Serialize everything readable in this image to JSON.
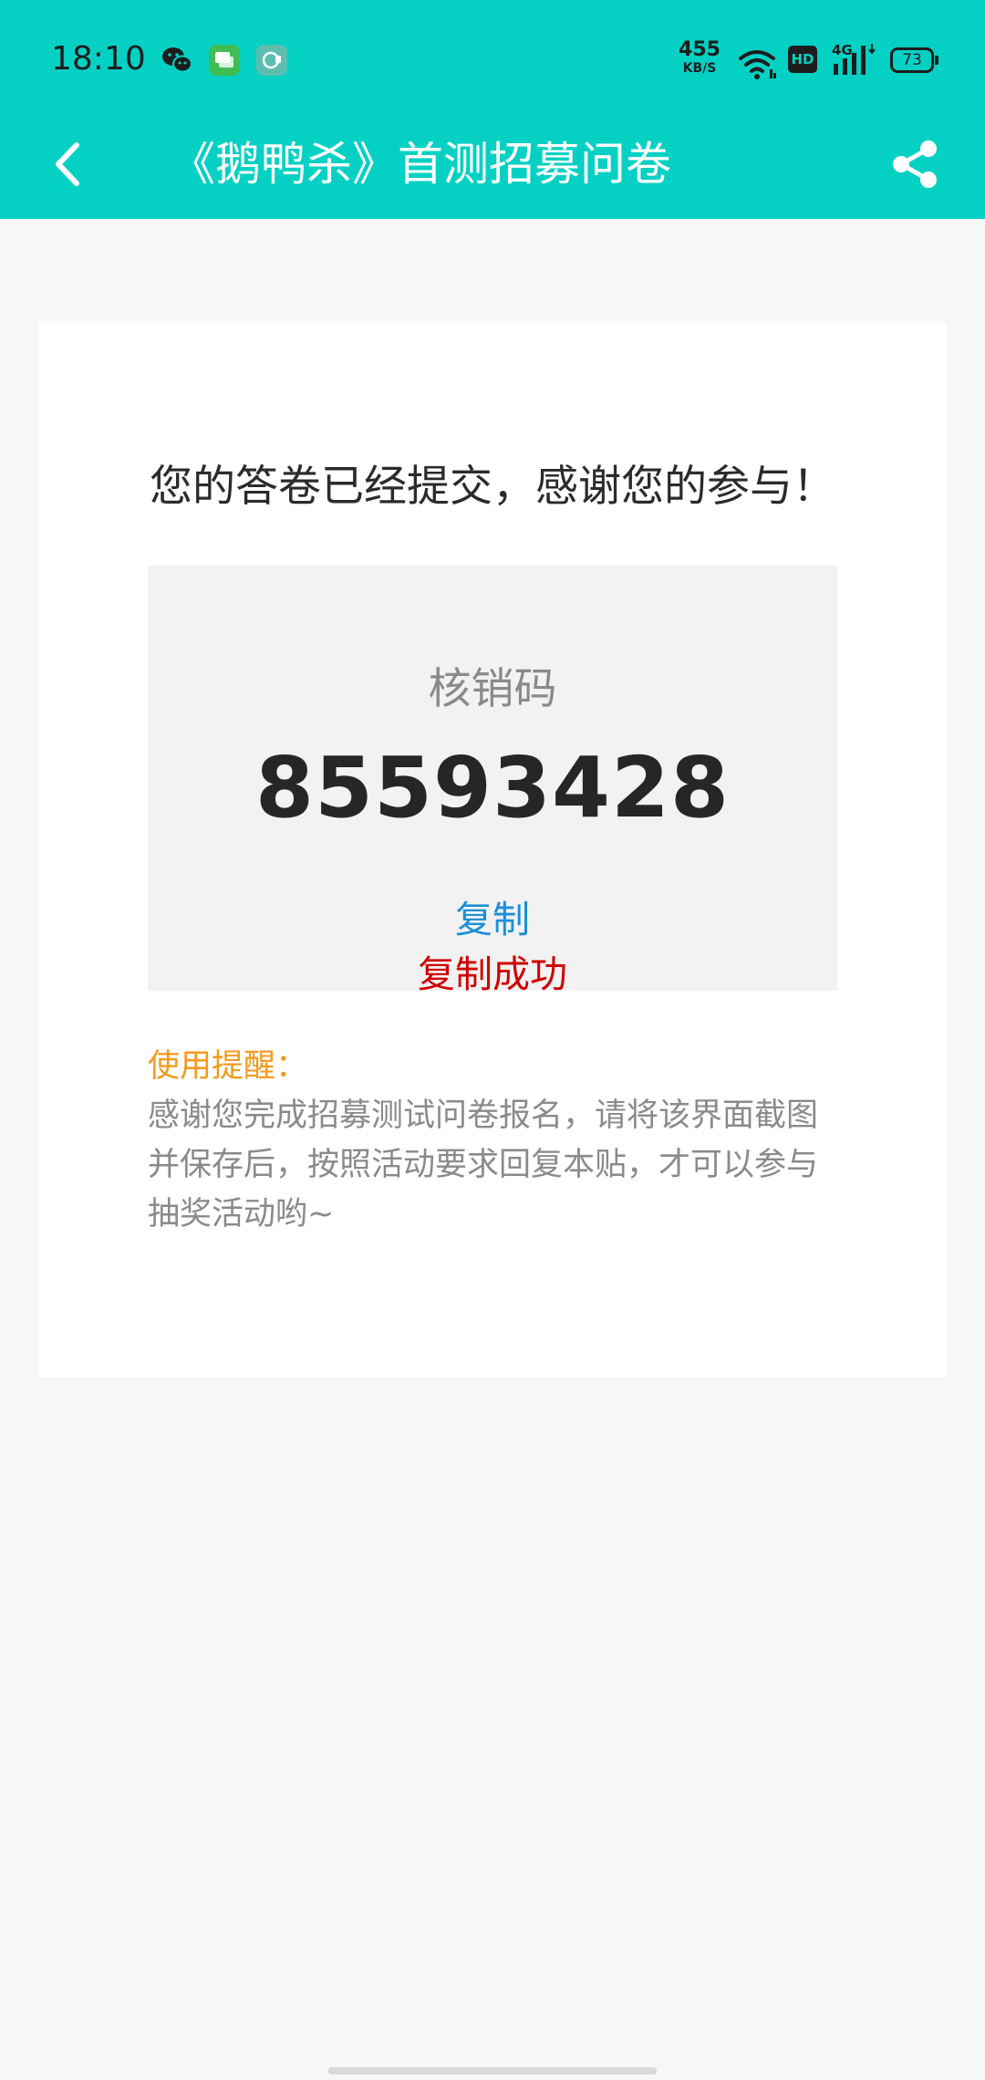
{
  "status_bar": {
    "time": "18:10",
    "net_speed_value": "455",
    "net_speed_unit": "KB/S",
    "hd_badge": "HD",
    "network_type": "4G",
    "battery_level": "73",
    "icons": [
      "wechat-icon",
      "message-icon",
      "chat-app-icon",
      "wifi-icon",
      "hd-icon",
      "signal-icon",
      "battery-icon"
    ]
  },
  "nav": {
    "title": "《鹅鸭杀》首测招募问卷",
    "back_icon": "chevron-left-icon",
    "share_icon": "share-icon"
  },
  "result": {
    "message": "您的答卷已经提交，感谢您的参与！",
    "code_label": "核销码",
    "code_value": "85593428",
    "copy_label": "复制",
    "copy_success": "复制成功"
  },
  "reminder": {
    "title": "使用提醒：",
    "body": "感谢您完成招募测试问卷报名，请将该界面截图并保存后，按照活动要求回复本贴，才可以参与抽奖活动哟~"
  },
  "colors": {
    "header_bg": "#04d1c3",
    "copy_link": "#1c8fd6",
    "copy_success": "#d00000",
    "reminder_title": "#f39a1e"
  }
}
